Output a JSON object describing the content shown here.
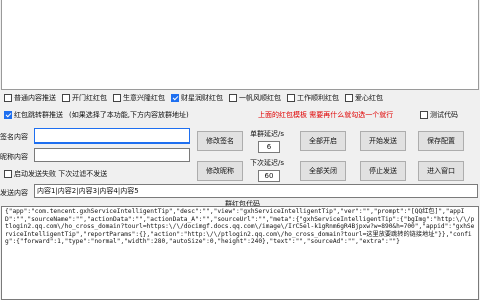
{
  "checkbox_rows": {
    "row1": [
      {
        "label": "普通内容推送",
        "checked": false
      },
      {
        "label": "开门红红包",
        "checked": false
      },
      {
        "label": "生意兴隆红包",
        "checked": false
      },
      {
        "label": "财星润财红包",
        "checked": true
      },
      {
        "label": "一帆风顺红包",
        "checked": false
      },
      {
        "label": "工作顺利红包",
        "checked": false
      },
      {
        "label": "爱心红包",
        "checked": false
      }
    ],
    "row2_checkbox": {
      "label": "红包跳转群推送",
      "checked": true
    },
    "row2_note": "(如果选择了本功能,下方内容放群地址)",
    "row2_red_note": "上面的红包模板 需要再什么就勾选一个就行",
    "test_code": {
      "label": "测试代码",
      "checked": false
    }
  },
  "form": {
    "sign_label": "签名内容",
    "sign_value": "",
    "nick_label": "昵称内容",
    "nick_value": "",
    "auto_resend": {
      "label": "启动发送失败 下次过滤不发送",
      "checked": false
    },
    "send_label": "发送内容",
    "send_value": "内容1|内容2|内容3|内容4|内容5"
  },
  "buttons": {
    "edit_sign": "修改签名",
    "edit_nick": "修改昵称",
    "start_all": "全部开启",
    "close_all": "全部关闭",
    "start_send": "开始发送",
    "stop_send": "停止发送",
    "save_config": "保存配置",
    "enter_window": "进入窗口"
  },
  "delays": {
    "single_label": "单群延迟/s",
    "single_value": "6",
    "next_label": "下次延迟/s",
    "next_value": "60"
  },
  "code_area": {
    "title": "群红包代码",
    "content": "{\"app\":\"com.tencent.gxhServiceIntelligentTip\",\"desc\":\"\",\"view\":\"gxhServiceIntelligentTip\",\"ver\":\"\",\"prompt\":\"[QQ红包]\",\"appID\":\"\",\"sourceName\":\"\",\"actionData\":\"\",\"actionData_A\":\"\",\"sourceUrl\":\"\",\"meta\":{\"gxhServiceIntelligentTip\":{\"bgImg\":\"http:\\/\\/ptlogin2.qq.com\\/ho_cross_domain?tourl=https:\\/\\/docimgf.docs.qq.com\\/image\\/IrC5el-k1gRnm6gR4Bjpxw?w=890&h=700\",\"appid\":\"gxhServiceIntelligentTip\",\"reportParams\":{},\"action\":\"http:\\/\\/ptlogin2.qq.com\\/ho_cross_domain?tourl=这里放要跳转的链接地址\"}},\"config\":{\"forward\":1,\"type\":\"normal\",\"width\":280,\"autoSize\":0,\"height\":240},\"text\":\"\",\"sourceAd\":\"\",\"extra\":\"\"}"
  }
}
